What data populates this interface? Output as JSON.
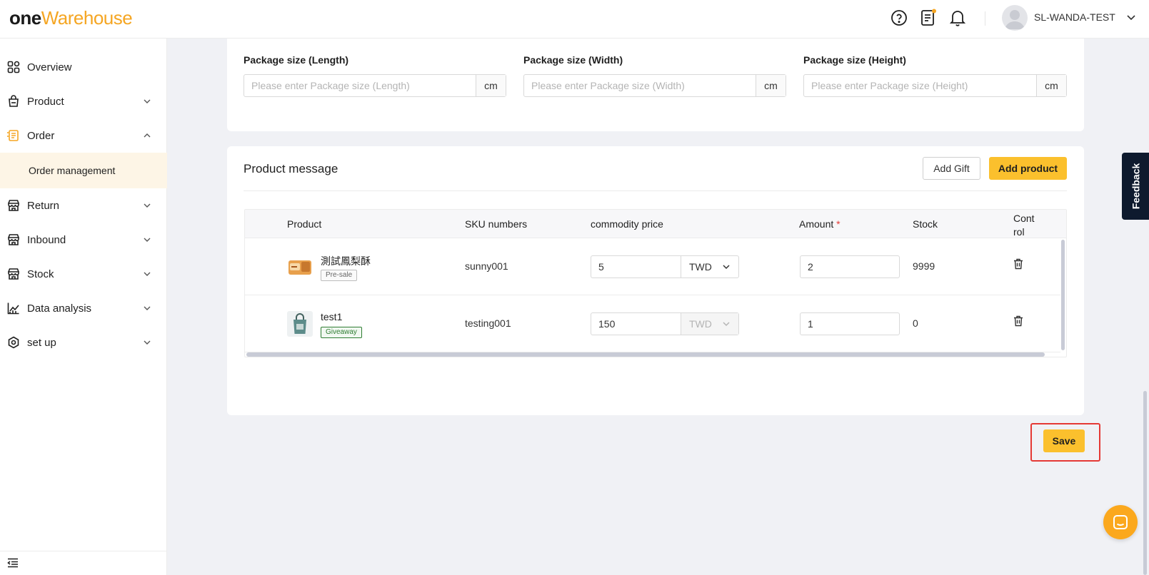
{
  "header": {
    "logo_one": "one",
    "logo_warehouse": "Warehouse",
    "username": "SL-WANDA-TEST",
    "icons": [
      "help-circle-icon",
      "clipboard-notice-icon",
      "bell-icon",
      "user-avatar-icon"
    ]
  },
  "sidebar": {
    "items": [
      {
        "label": "Overview",
        "icon": "overview-grid-icon"
      },
      {
        "label": "Product",
        "icon": "product-bag-icon"
      },
      {
        "label": "Order",
        "icon": "order-list-icon"
      },
      {
        "label": "Return",
        "icon": "return-store-icon"
      },
      {
        "label": "Inbound",
        "icon": "inbound-store-icon"
      },
      {
        "label": "Stock",
        "icon": "stock-store-icon"
      },
      {
        "label": "Data analysis",
        "icon": "chart-line-icon"
      },
      {
        "label": "set up",
        "icon": "settings-hex-icon"
      }
    ],
    "sub_active": "Order management"
  },
  "package": {
    "length_label": "Package size (Length)",
    "length_placeholder": "Please enter Package size (Length)",
    "width_label": "Package size (Width)",
    "width_placeholder": "Please enter Package size (Width)",
    "height_label": "Package size (Height)",
    "height_placeholder": "Please enter Package size (Height)",
    "unit": "cm"
  },
  "product_message": {
    "title": "Product message",
    "add_gift_label": "Add Gift",
    "add_product_label": "Add product",
    "columns": {
      "product": "Product",
      "sku": "SKU numbers",
      "price": "commodity price",
      "amount": "Amount",
      "required_mark": "*",
      "stock": "Stock",
      "control": "Cont rol"
    },
    "rows": [
      {
        "name": "測試鳳梨酥",
        "tag": "Pre-sale",
        "sku": "sunny001",
        "price": "5",
        "currency": "TWD",
        "amount": "2",
        "stock": "9999"
      },
      {
        "name": "test1",
        "tag": "Giveaway",
        "sku": "testing001",
        "price": "150",
        "currency": "TWD",
        "amount": "1",
        "stock": "0"
      }
    ]
  },
  "save_label": "Save",
  "feedback_label": "Feedback",
  "colors": {
    "accent": "#fbc02d",
    "brand_orange": "#f5a623",
    "highlight_red": "#e53935",
    "feedback_bg": "#0e1a2e"
  }
}
